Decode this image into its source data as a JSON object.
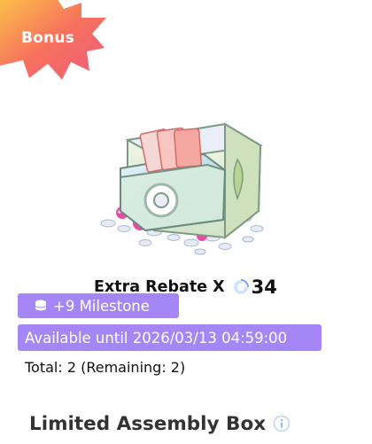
{
  "badge": {
    "label": "Bonus",
    "colors": [
      "#fbb03b",
      "#f7725d",
      "#ef5f7a"
    ]
  },
  "reward": {
    "title": "Extra Rebate X",
    "count": "34",
    "image_icon": "treasure-chest-icon",
    "rebate_icon": "rebate-token-icon"
  },
  "tags": {
    "milestone": "+9 Milestone",
    "milestone_icon": "coin-stack-icon",
    "availability": "Available until 2026/03/13 04:59:00",
    "color": "#a486f7"
  },
  "total_text": "Total: 2 (Remaining: 2)",
  "section": {
    "title": "Limited Assembly Box",
    "info_icon": "info-icon"
  }
}
